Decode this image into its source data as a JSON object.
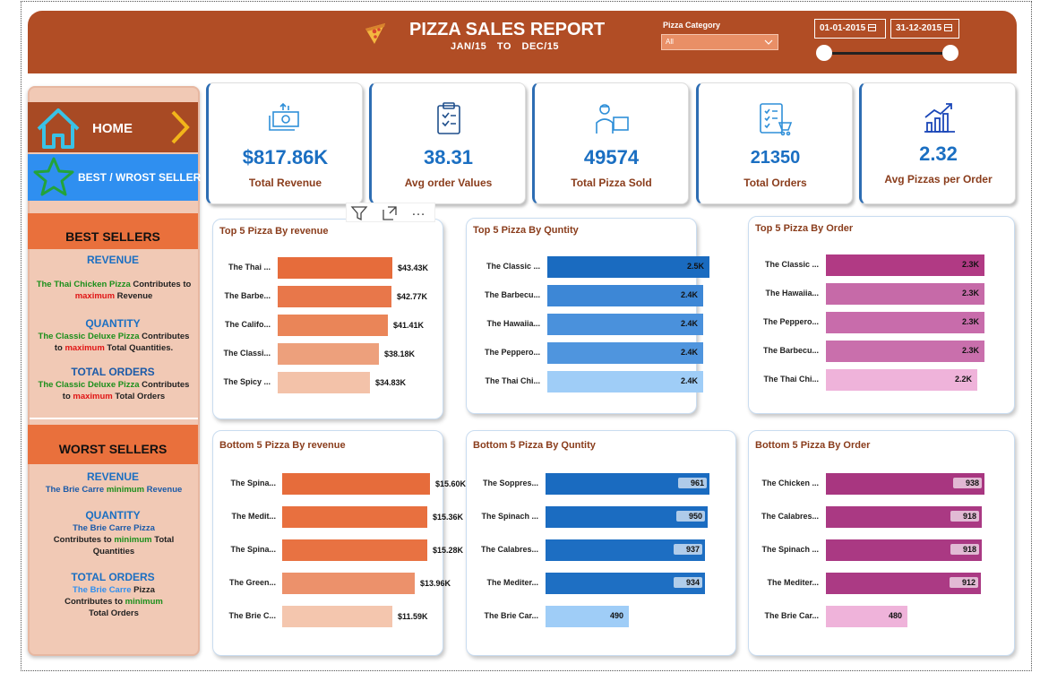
{
  "header": {
    "title": "PIZZA SALES REPORT",
    "period_start": "JAN/15",
    "period_to": "TO",
    "period_end": "DEC/15",
    "category_label": "Pizza Category",
    "category_value": "All",
    "date_start": "01-01-2015",
    "date_end": "31-12-2015"
  },
  "nav": {
    "home_label": "HOME",
    "best_label": "BEST / WROST SELLER"
  },
  "best": {
    "heading": "BEST SELLERS",
    "revenue_head": "REVENUE",
    "revenue_l1a": "The Thai Chicken Pizza",
    "revenue_l1b": " Contributes to",
    "revenue_l2": "maximum",
    "revenue_l2b": " Revenue",
    "qty_head": "QUANTITY",
    "qty_l1a": "The Classic Deluxe Pizza",
    "qty_l1b": " Contributes",
    "qty_l2a": "to ",
    "qty_l2b": "maximum",
    "qty_l2c": " Total Quantities.",
    "orders_head": "TOTAL ORDERS",
    "orders_l1a": "The Classic Deluxe Pizza",
    "orders_l1b": " Contributes",
    "orders_l2a": "to ",
    "orders_l2b": "maximum",
    "orders_l2c": " Total Orders"
  },
  "worst": {
    "heading": "WORST SELLERS",
    "revenue_head": "REVENUE",
    "revenue_l1a": "The Brie Carre ",
    "revenue_l1b": "minimum",
    "revenue_l1c": " Revenue",
    "qty_head": "QUANTITY",
    "qty_l1": "The Brie Carre Pizza",
    "qty_l2a": "Contributes to ",
    "qty_l2b": "minimum",
    "qty_l2c": " Total",
    "qty_l3": "Quantities",
    "orders_head": "TOTAL ORDERS",
    "orders_l1a": "The Brie Carre",
    "orders_l1b": " Pizza",
    "orders_l2a": "Contributes to ",
    "orders_l2b": "minimum",
    "orders_l3": "Total Orders"
  },
  "kpis": [
    {
      "value": "$817.86K",
      "label": "Total Revenue",
      "icon": "money-icon"
    },
    {
      "value": "38.31",
      "label": "Avg order Values",
      "icon": "clipboard-icon"
    },
    {
      "value": "49574",
      "label": "Total Pizza Sold",
      "icon": "delivery-icon"
    },
    {
      "value": "21350",
      "label": "Total Orders",
      "icon": "order-list-icon"
    },
    {
      "value": "2.32",
      "label": "Avg Pizzas per Order",
      "icon": "growth-chart-icon"
    }
  ],
  "colors": {
    "header_bg": "#b14d25",
    "sidebar_bg": "#f1c9b5",
    "accent_orange": "#e9703c",
    "accent_blue": "#2f8ff0",
    "kpi_value": "#1b6fc2"
  },
  "chart_data": [
    {
      "id": "top-revenue",
      "type": "bar",
      "title": "Top 5 Pizza  By revenue",
      "categories": [
        "The Thai ...",
        "The Barbe...",
        "The Califo...",
        "The Classi...",
        "The Spicy ..."
      ],
      "values": [
        43.43,
        42.77,
        41.41,
        38.18,
        34.83
      ],
      "value_labels": [
        "$43.43K",
        "$42.77K",
        "$41.41K",
        "$38.18K",
        "$34.83K"
      ],
      "colors": [
        "#e66c3b",
        "#e8774a",
        "#ea8558",
        "#eda07c",
        "#f3c2a9"
      ],
      "xlim": [
        0,
        48
      ],
      "label_inside": false
    },
    {
      "id": "top-quantity",
      "type": "bar",
      "title": "Top 5 Pizza  By Quntity",
      "categories": [
        "The Classic ...",
        "The Barbecu...",
        "The Hawaiia...",
        "The Peppero...",
        "The Thai Chi..."
      ],
      "values": [
        2.5,
        2.4,
        2.4,
        2.4,
        2.4
      ],
      "value_labels": [
        "2.5K",
        "2.4K",
        "2.4K",
        "2.4K",
        "2.4K"
      ],
      "colors": [
        "#1a6bc0",
        "#3d87d6",
        "#4a91dc",
        "#4f95de",
        "#9fcdf7"
      ],
      "xlim": [
        0,
        2.7
      ],
      "label_inside": true
    },
    {
      "id": "top-orders",
      "type": "bar",
      "title": "Top 5 Pizza  By Order",
      "categories": [
        "The Classic ...",
        "The Hawaiia...",
        "The Peppero...",
        "The Barbecu...",
        "The Thai Chi..."
      ],
      "values": [
        2.3,
        2.3,
        2.3,
        2.3,
        2.2
      ],
      "value_labels": [
        "2.3K",
        "2.3K",
        "2.3K",
        "2.3K",
        "2.2K"
      ],
      "colors": [
        "#b13a84",
        "#c66aa8",
        "#c86cab",
        "#c96fac",
        "#efb3da"
      ],
      "xlim": [
        0,
        2.5
      ],
      "label_inside": true
    },
    {
      "id": "bottom-revenue",
      "type": "bar",
      "title": "Bottom 5 Pizza  By revenue",
      "categories": [
        "The Spina...",
        "The Medit...",
        "The Spina...",
        "The Green...",
        "The Brie C..."
      ],
      "values": [
        15.6,
        15.36,
        15.28,
        13.96,
        11.59
      ],
      "value_labels": [
        "$15.60K",
        "$15.36K",
        "$15.28K",
        "$13.96K",
        "$11.59K"
      ],
      "colors": [
        "#e66c3b",
        "#e8703f",
        "#e87242",
        "#ec916b",
        "#f4c6ae"
      ],
      "xlim": [
        0,
        17.5
      ],
      "label_inside": false
    },
    {
      "id": "bottom-quantity",
      "type": "bar",
      "title": "Bottom 5 Pizza  By Quntity",
      "categories": [
        "The Soppres...",
        "The Spinach ...",
        "The Calabres...",
        "The Mediter...",
        "The Brie Car..."
      ],
      "values": [
        961,
        950,
        937,
        934,
        490
      ],
      "value_labels": [
        "961",
        "950",
        "937",
        "934",
        "490"
      ],
      "colors": [
        "#1a6bc0",
        "#1b6cc1",
        "#1d6ec2",
        "#1e6fc3",
        "#9fcdf7"
      ],
      "xlim": [
        0,
        1050
      ],
      "label_inside": true
    },
    {
      "id": "bottom-orders",
      "type": "bar",
      "title": "Bottom 5 Pizza  By Order",
      "categories": [
        "The Chicken ...",
        "The Calabres...",
        "The Spinach ...",
        "The Mediter...",
        "The Brie Car..."
      ],
      "values": [
        938,
        918,
        918,
        912,
        480
      ],
      "value_labels": [
        "938",
        "918",
        "918",
        "912",
        "480"
      ],
      "colors": [
        "#a83680",
        "#aa3983",
        "#aa3983",
        "#ab3a84",
        "#efb3da"
      ],
      "xlim": [
        0,
        1020
      ],
      "label_inside": true
    }
  ]
}
